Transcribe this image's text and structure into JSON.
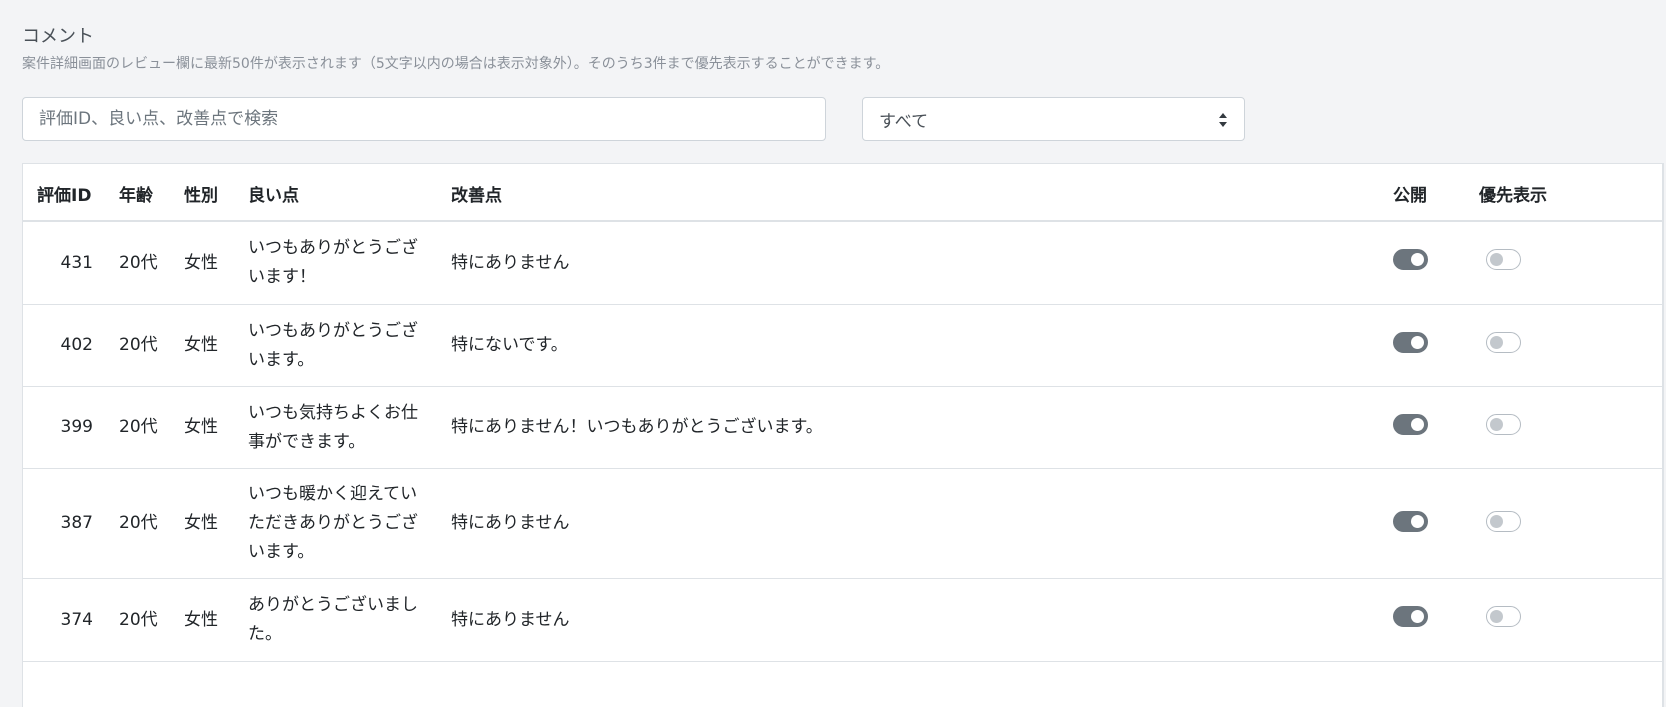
{
  "section": {
    "title": "コメント",
    "description": "案件詳細画面のレビュー欄に最新50件が表示されます（5文字以内の場合は表示対象外）。そのうち3件まで優先表示することができます。"
  },
  "search": {
    "placeholder": "評価ID、良い点、改善点で検索",
    "value": ""
  },
  "filter": {
    "selected": "すべて"
  },
  "table": {
    "headers": {
      "id": "評価ID",
      "age": "年齢",
      "gender": "性別",
      "good": "良い点",
      "improve": "改善点",
      "public": "公開",
      "priority": "優先表示"
    },
    "rows": [
      {
        "id": "431",
        "age": "20代",
        "gender": "女性",
        "good": "いつもありがとうございます！",
        "improve": "特にありません",
        "public": true,
        "priority": false
      },
      {
        "id": "402",
        "age": "20代",
        "gender": "女性",
        "good": "いつもありがとうございます。",
        "improve": "特にないです。",
        "public": true,
        "priority": false
      },
      {
        "id": "399",
        "age": "20代",
        "gender": "女性",
        "good": "いつも気持ちよくお仕事ができます。",
        "improve": "特にありません！いつもありがとうございます。",
        "public": true,
        "priority": false
      },
      {
        "id": "387",
        "age": "20代",
        "gender": "女性",
        "good": "いつも暖かく迎えていただきありがとうございます。",
        "improve": "特にありません",
        "public": true,
        "priority": false
      },
      {
        "id": "374",
        "age": "20代",
        "gender": "女性",
        "good": "ありがとうございました。",
        "improve": "特にありません",
        "public": true,
        "priority": false
      }
    ]
  },
  "colors": {
    "toggle_on": "#6c757d",
    "toggle_off_border": "#b5bcc3",
    "page_bg": "#f3f4f6"
  }
}
